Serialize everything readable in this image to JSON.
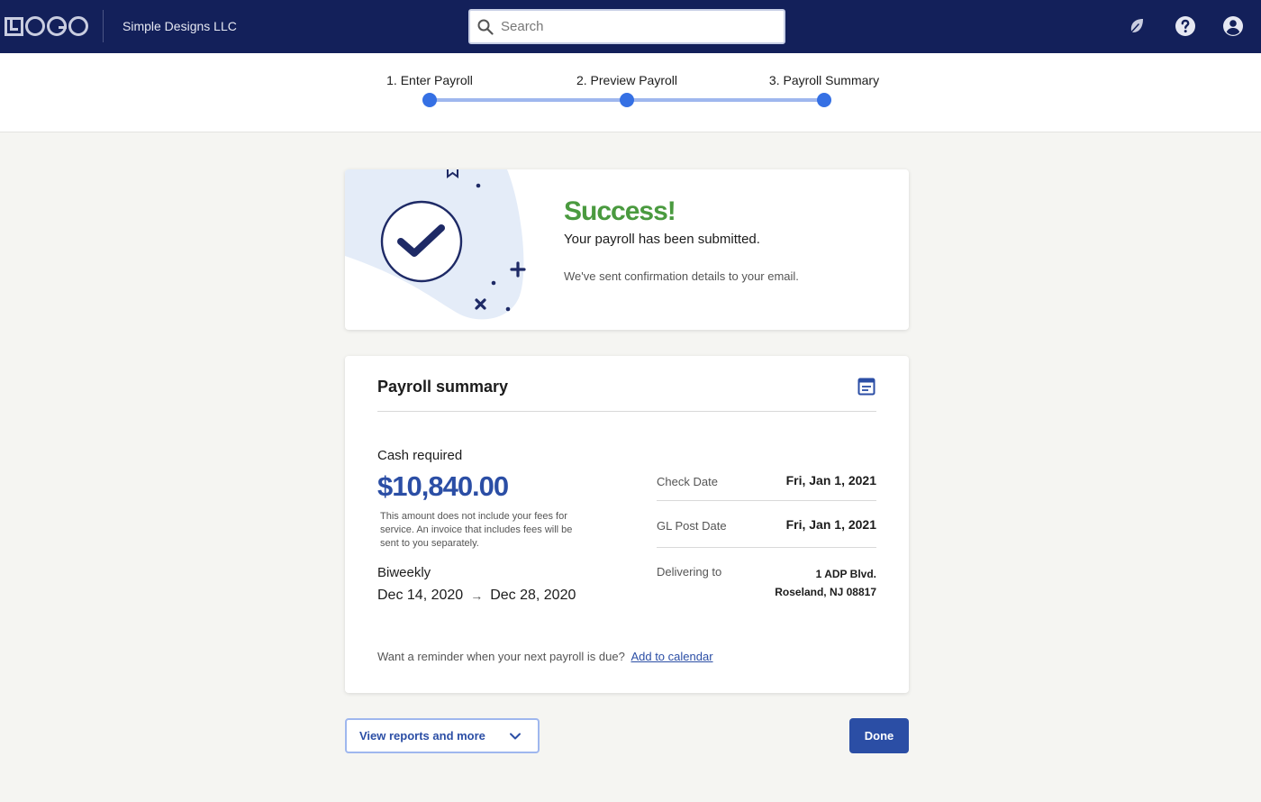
{
  "header": {
    "logo_text": "LOGO",
    "company": "Simple Designs LLC",
    "search_placeholder": "Search",
    "icons": [
      "leaf-icon",
      "help-icon",
      "user-account-icon"
    ]
  },
  "stepper": {
    "steps": [
      {
        "label": "1. Enter Payroll"
      },
      {
        "label": "2. Preview Payroll"
      },
      {
        "label": "3. Payroll Summary"
      }
    ],
    "active_step": 3
  },
  "success": {
    "title": "Success!",
    "message": "Your payroll has been submitted.",
    "note": "We've sent confirmation details to your email."
  },
  "summary": {
    "title": "Payroll summary",
    "cash_label": "Cash required",
    "cash_amount": "$10,840.00",
    "cash_note": "This amount does not include your fees for service. An invoice that includes fees will be sent to you separately.",
    "frequency": "Biweekly",
    "period_start": "Dec 14, 2020",
    "period_arrow": "→",
    "period_end": "Dec 28, 2020",
    "details": [
      {
        "label": "Check Date",
        "value": "Fri, Jan 1, 2021"
      },
      {
        "label": "GL Post Date",
        "value": "Fri, Jan 1, 2021"
      },
      {
        "label": "Delivering to",
        "value_line1": "1 ADP Blvd.",
        "value_line2": "Roseland, NJ 08817"
      }
    ],
    "reminder_text": "Want a reminder when your next payroll is due?",
    "reminder_link": "Add to calendar"
  },
  "actions": {
    "view_reports_label": "View reports and more",
    "done_label": "Done"
  },
  "colors": {
    "header_bg": "#13205a",
    "accent_blue": "#2b4ea5",
    "step_blue": "#3570e4",
    "success_green": "#4a9a3f"
  }
}
